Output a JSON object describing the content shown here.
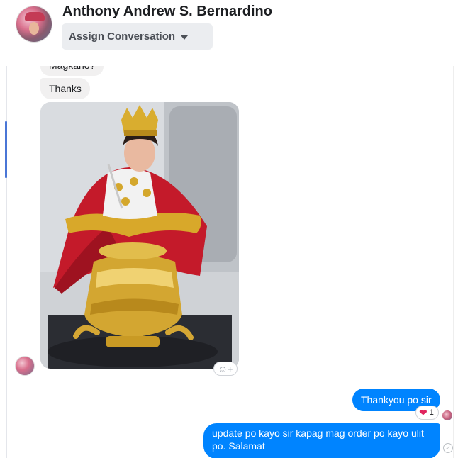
{
  "header": {
    "contact_name": "Anthony Andrew S. Bernardino",
    "assign_label": "Assign Conversation",
    "assign_icon": "caret-down-icon"
  },
  "messages": {
    "incoming_partial": "Magkano?",
    "incoming_thanks": "Thanks",
    "photo_subject": "photo",
    "add_reaction_icon": "smiley-plus-icon",
    "outgoing_thankyou": "Thankyou po sir",
    "outgoing_update": "update po kayo sir kapag mag order po kayo ulit po. Salamat",
    "reaction_icon": "heart-icon",
    "reaction_count": "1"
  },
  "colors": {
    "outgoing_bubble": "#0084ff",
    "incoming_bubble": "#f1f0f0",
    "heart": "#e0245e"
  }
}
